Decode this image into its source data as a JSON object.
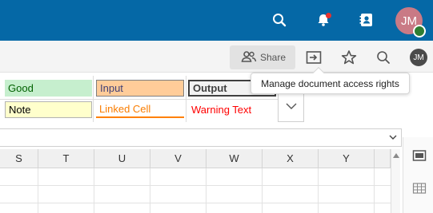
{
  "topbar": {
    "bg_color": "#0568a6",
    "icons": [
      "search-icon",
      "bell-icon",
      "contacts-icon"
    ],
    "user_initials": "JM",
    "status_color": "#2e7d32",
    "notification_color": "#e9322d"
  },
  "docbar": {
    "share_label": "Share",
    "icons": [
      "share-users-icon",
      "move-to-folder-icon",
      "star-icon",
      "search-icon"
    ],
    "user_initials": "JM"
  },
  "tooltip": {
    "text": "Manage document access rights"
  },
  "cell_styles": {
    "row1": [
      {
        "label": "Good",
        "bg": "#c6efce",
        "fg": "#006100"
      },
      {
        "label": "Input",
        "bg": "#ffcc99",
        "fg": "#3f3f76"
      },
      {
        "label": "Output",
        "bg": "#f2f2f2",
        "fg": "#3f3f3f"
      }
    ],
    "row2": [
      {
        "label": "Note",
        "bg": "#ffffcc",
        "fg": "#000000"
      },
      {
        "label": "Linked Cell",
        "bg": "#ffffff",
        "fg": "#fa7d00"
      },
      {
        "label": "Warning Text",
        "bg": "#ffffff",
        "fg": "#ff0000"
      }
    ]
  },
  "grid": {
    "columns": [
      "S",
      "T",
      "U",
      "V",
      "W",
      "X",
      "Y"
    ]
  },
  "sidebar": {
    "icons": [
      "sheet-properties-icon",
      "table-icon"
    ]
  }
}
